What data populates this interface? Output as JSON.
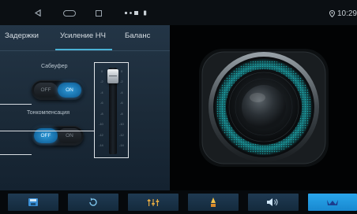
{
  "status_bar": {
    "time": "10:29",
    "icons": [
      "back-icon",
      "home-icon",
      "recent-apps-icon",
      "notification-icons",
      "location-icon"
    ]
  },
  "tabs": [
    {
      "label": "Задержки",
      "active": false
    },
    {
      "label": "Усиление НЧ",
      "active": true
    },
    {
      "label": "Баланс",
      "active": false
    }
  ],
  "subwoofer": {
    "label": "Сабвуфер",
    "off_label": "OFF",
    "on_label": "ON",
    "state": "ON"
  },
  "loudness": {
    "label": "Тонкомпенсация",
    "off_label": "OFF",
    "on_label": "ON",
    "state": "OFF"
  },
  "slider": {
    "left_ticks": [
      "0",
      "-2",
      "-4",
      "-6",
      "-8",
      "-10",
      "-12",
      "-14"
    ],
    "right_ticks": [
      "0",
      "-2",
      "-4",
      "-6",
      "-8",
      "-10",
      "-12",
      "-14"
    ],
    "value": "0"
  },
  "bottom_bar": {
    "buttons": [
      "save-icon",
      "reset-icon",
      "equalizer-icon",
      "fader-icon",
      "volume-icon",
      "settings-icon"
    ]
  },
  "colors": {
    "accent": "#2aa6ec",
    "panel": "#1f3042",
    "active_toggle": "#1f86c8"
  }
}
